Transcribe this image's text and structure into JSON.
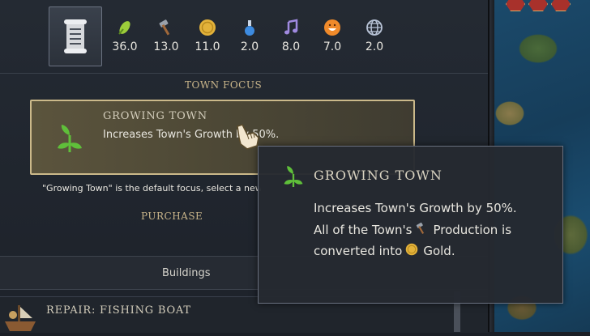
{
  "yields": [
    {
      "icon": "food-icon",
      "value": "36.0"
    },
    {
      "icon": "production-icon",
      "value": "13.0"
    },
    {
      "icon": "gold-icon",
      "value": "11.0"
    },
    {
      "icon": "science-icon",
      "value": "2.0"
    },
    {
      "icon": "culture-icon",
      "value": "8.0"
    },
    {
      "icon": "happiness-icon",
      "value": "7.0"
    },
    {
      "icon": "influence-icon",
      "value": "2.0"
    }
  ],
  "sections": {
    "town_focus": "TOWN FOCUS",
    "purchase": "PURCHASE"
  },
  "focus_card": {
    "title": "GROWING TOWN",
    "description": "Increases Town's Growth by 50%."
  },
  "hint": "\"Growing Town\" is the default focus, select a new focus by clicking above.",
  "buildings": {
    "label": "Buildings"
  },
  "repair": {
    "label": "REPAIR: FISHING BOAT"
  },
  "tooltip": {
    "title": "GROWING TOWN",
    "line1": "Increases Town's Growth by 50%.",
    "line2_a": "All of the Town's",
    "line2_b": "Production is",
    "line3_a": "converted into",
    "line3_b": "Gold."
  },
  "colors": {
    "accent_gold": "#cbb98a",
    "panel_bg": "#242a33",
    "leaf_green": "#5fbf3a"
  }
}
